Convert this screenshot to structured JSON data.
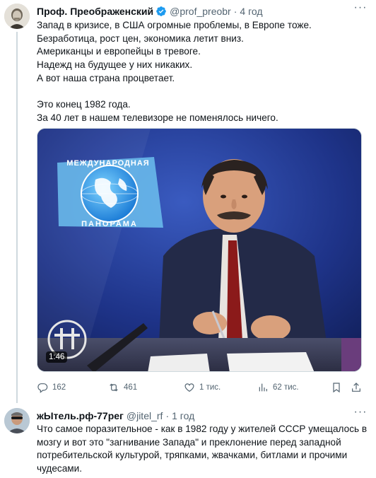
{
  "tweet": {
    "author_name": "Проф. Преображенский",
    "author_handle": "@prof_preobr",
    "separator": "·",
    "time": "4 год",
    "lines": [
      "Запад в кризисе, в США огромные проблемы, в Европе тоже.",
      "Безработица, рост цен, экономика летит вниз.",
      "Американцы и европейцы в тревоге.",
      "Надежд на будущее у них никаких.",
      "А вот наша страна процветает.",
      "",
      "Это конец 1982 года.",
      "За 40 лет в нашем телевизоре не поменялось ничего."
    ],
    "video": {
      "duration": "1:46",
      "logo_top": "МЕЖДУНАРОДНАЯ",
      "logo_bottom": "ПАНОРАМА"
    },
    "actions": {
      "replies": "162",
      "retweets": "461",
      "likes": "1 тис.",
      "views": "62 тис."
    }
  },
  "reply": {
    "author_name": "жЫтель.рф-77рег",
    "author_handle": "@jitel_rf",
    "separator": "·",
    "time": "1 год",
    "text": "Что самое поразительное - как в 1982 году у жителей СССР умещалось в мозгу и вот это \"загнивание Запада\" и преклонение перед западной потребительской культурой, тряпками, жвачками, битлами и прочими чудесами."
  },
  "colors": {
    "text": "#0f1419",
    "secondary": "#536471",
    "verified": "#1d9bf0",
    "border": "#cfd9de"
  }
}
